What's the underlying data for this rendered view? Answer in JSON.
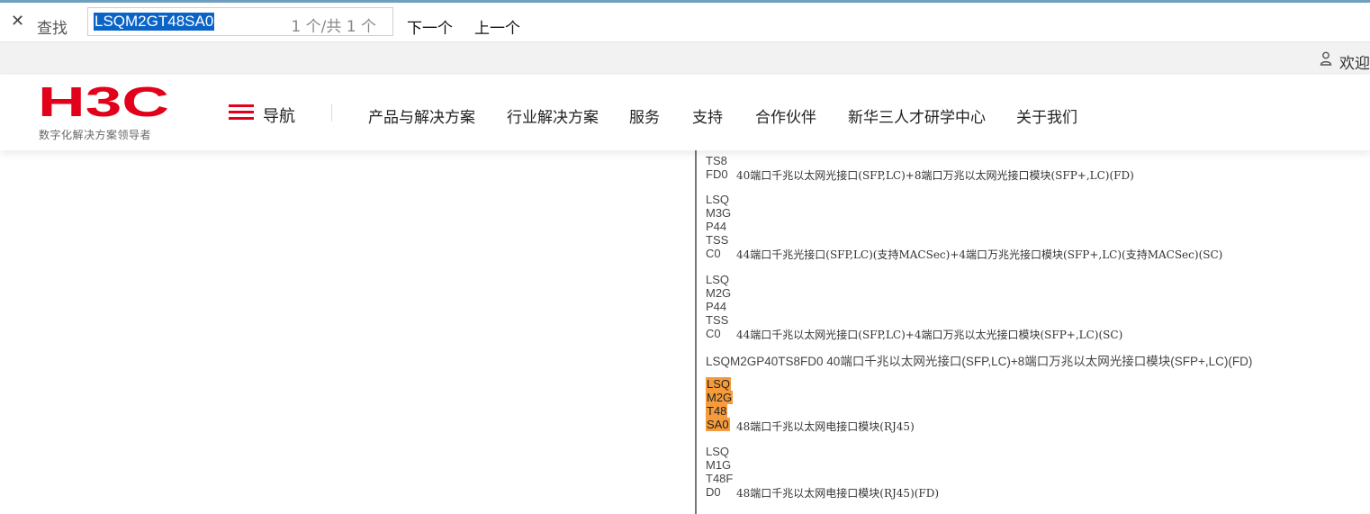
{
  "find_bar": {
    "close_glyph": "✕",
    "label": "查找",
    "query": "LSQM2GT48SA0",
    "match_count": "1 个/共 1 个",
    "next_label": "下一个",
    "prev_label": "上一个"
  },
  "utility_bar": {
    "welcome": "欢迎",
    "user_icon": "user-icon"
  },
  "header": {
    "logo_text": "H3C",
    "logo_tagline": "数字化解决方案领导者",
    "brand_color": "#e2001a",
    "nav_label": "导航",
    "nav_items": [
      "产品与解决方案",
      "行业解决方案",
      "服务",
      "支持",
      "合作伙伴",
      "新华三人才研学中心",
      "关于我们"
    ]
  },
  "content": {
    "row1": {
      "code_lines": [
        "TS8",
        "FD0"
      ],
      "desc": "40端口千兆以太网光接口(SFP,LC)+8端口万兆以太网光接口模块(SFP+,LC)(FD)"
    },
    "row2": {
      "code_lines": [
        "LSQ",
        "M3G",
        "P44",
        "TSS",
        "C0"
      ],
      "desc": "44端口千兆光接口(SFP,LC)(支持MACSec)+4端口万兆光接口模块(SFP+,LC)(支持MACSec)(SC)"
    },
    "row3": {
      "code_lines": [
        "LSQ",
        "M2G",
        "P44",
        "TSS",
        "C0"
      ],
      "desc": "44端口千兆以太网光接口(SFP,LC)+4端口万兆以太光接口模块(SFP+,LC)(SC)"
    },
    "row4": {
      "full_text": "LSQM2GP40TS8FD0 40端口千兆以太网光接口(SFP,LC)+8端口万兆以太网光接口模块(SFP+,LC)(FD)"
    },
    "row5": {
      "code_lines": [
        "LSQ",
        "M2G",
        "T48",
        "SA0"
      ],
      "desc": "48端口千兆以太网电接口模块(RJ45)",
      "highlight_color": "#f59b3b"
    },
    "row6": {
      "code_lines": [
        "LSQ",
        "M1G",
        "T48F",
        "D0"
      ],
      "desc": "48端口千兆以太网电接口模块(RJ45)(FD)"
    }
  }
}
